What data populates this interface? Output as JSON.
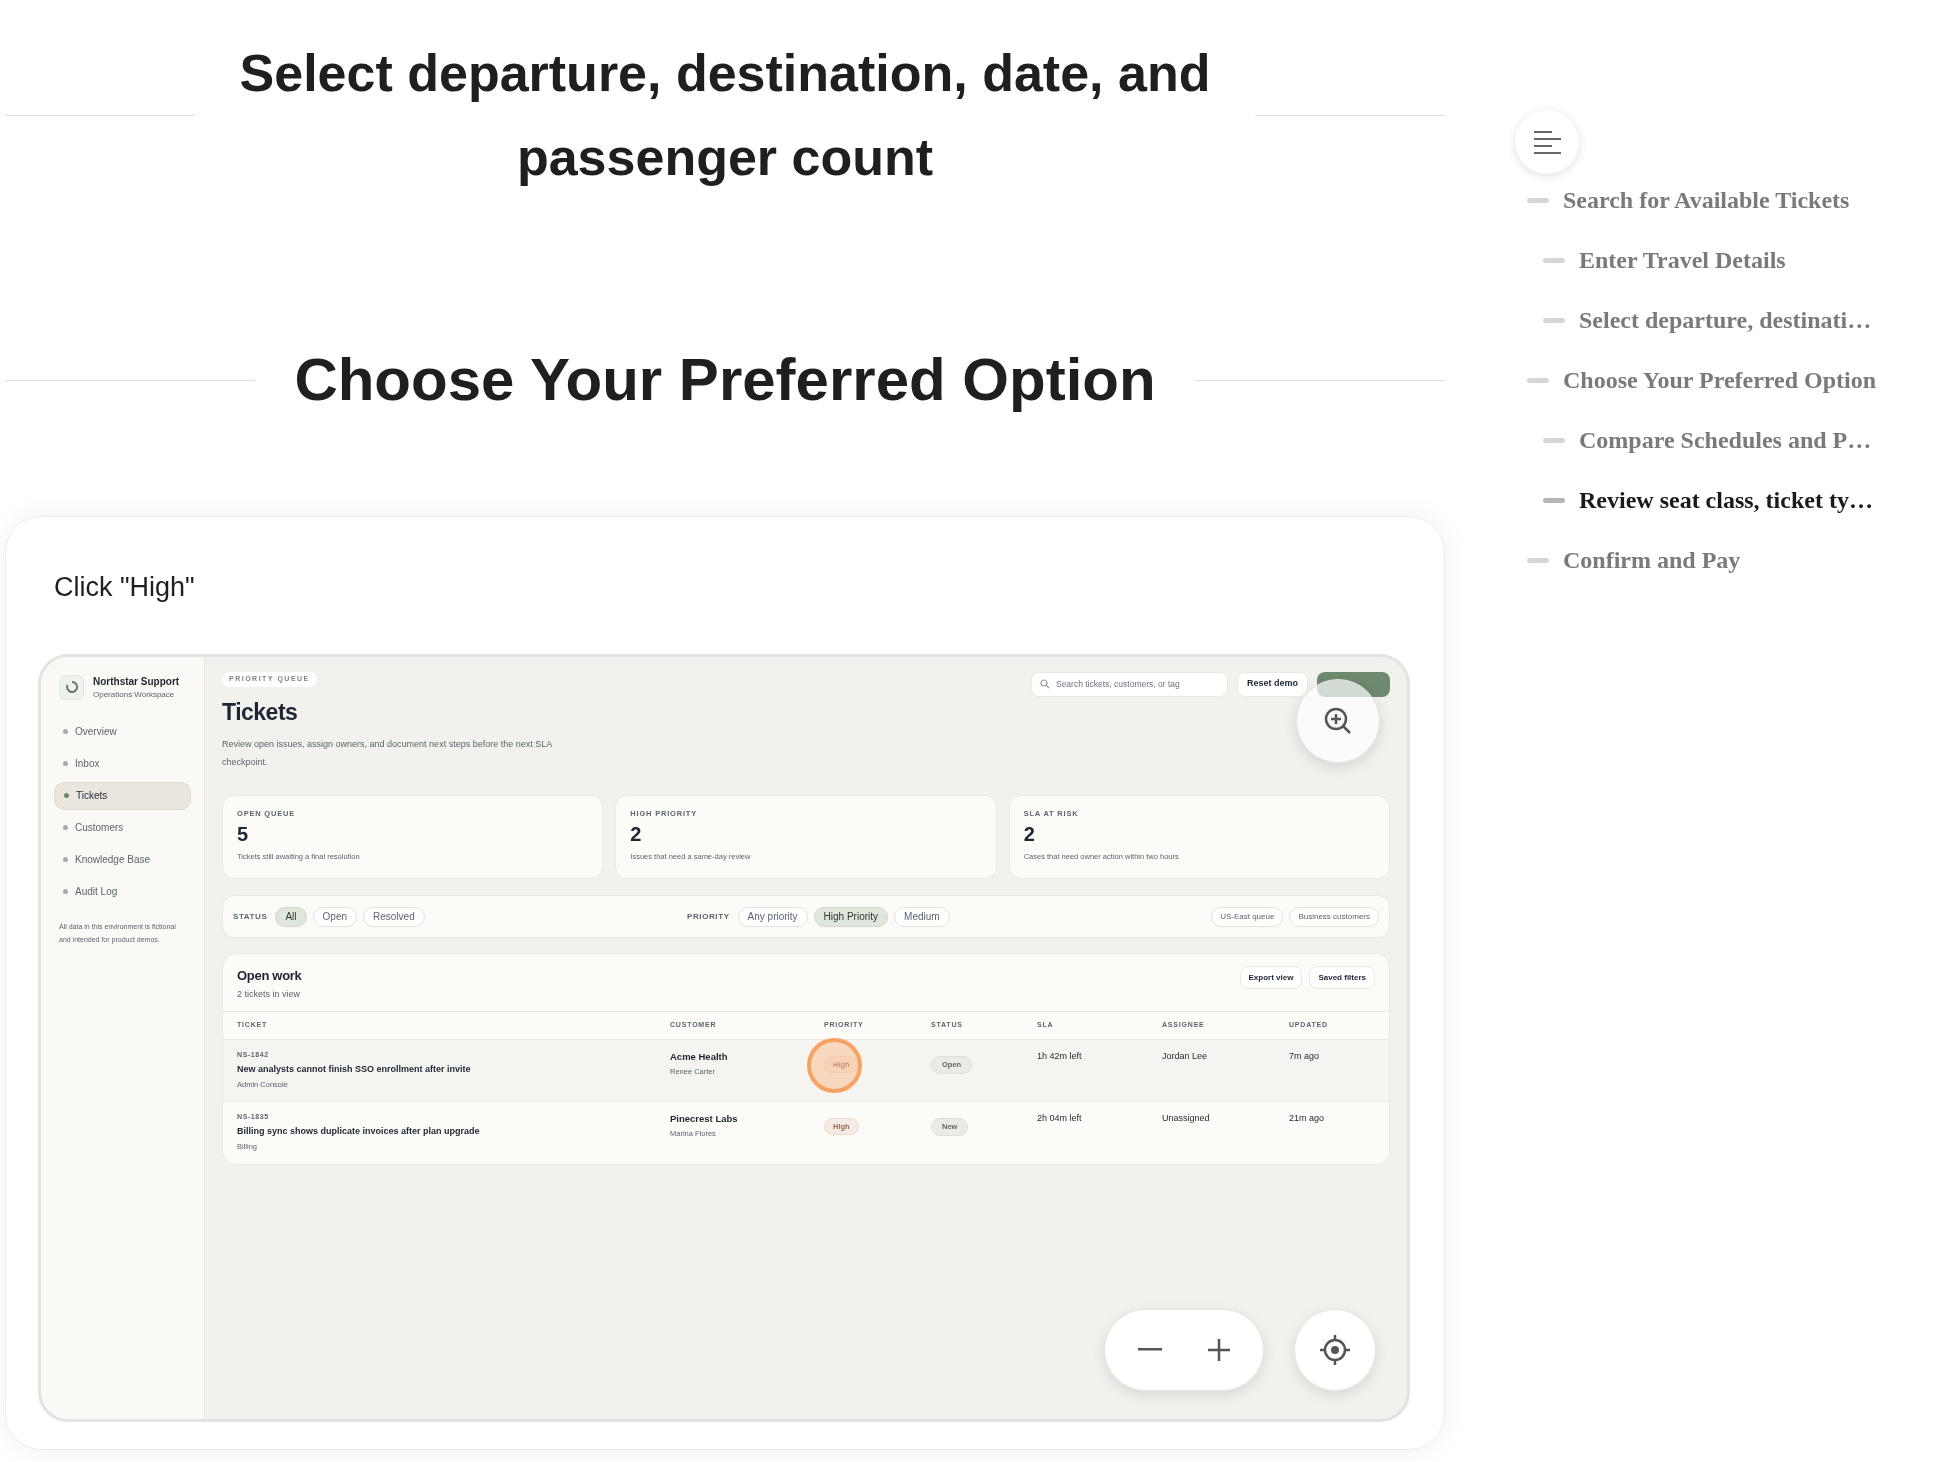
{
  "headings": [
    {
      "text": "Select departure, destination, date, and passenger count"
    },
    {
      "text": "Choose Your Preferred Option"
    }
  ],
  "step": {
    "instruction": "Click \"High\""
  },
  "app": {
    "brand": {
      "name": "Northstar Support",
      "subtitle": "Operations Workspace"
    },
    "nav": [
      {
        "label": "Overview",
        "selected": false
      },
      {
        "label": "Inbox",
        "selected": false
      },
      {
        "label": "Tickets",
        "selected": true
      },
      {
        "label": "Customers",
        "selected": false
      },
      {
        "label": "Knowledge Base",
        "selected": false
      },
      {
        "label": "Audit Log",
        "selected": false
      }
    ],
    "footnote": "All data in this environment is fictional and intended for product demos.",
    "eyebrow": "PRIORITY QUEUE",
    "title": "Tickets",
    "description": "Review open issues, assign owners, and document next steps before the next SLA checkpoint.",
    "search": {
      "placeholder": "Search tickets, customers, or tag"
    },
    "reset_button": "Reset demo",
    "stats": [
      {
        "label": "OPEN QUEUE",
        "value": "5",
        "note": "Tickets still awaiting a final resolution"
      },
      {
        "label": "HIGH PRIORITY",
        "value": "2",
        "note": "Issues that need a same-day review"
      },
      {
        "label": "SLA AT RISK",
        "value": "2",
        "note": "Cases that need owner action within two hours"
      }
    ],
    "filters": {
      "status": {
        "label": "STATUS",
        "chips": [
          {
            "label": "All",
            "selected": true
          },
          {
            "label": "Open",
            "selected": false
          },
          {
            "label": "Resolved",
            "selected": false
          }
        ]
      },
      "priority": {
        "label": "PRIORITY",
        "chips": [
          {
            "label": "Any priority",
            "selected": false
          },
          {
            "label": "High Priority",
            "selected": true
          },
          {
            "label": "Medium",
            "selected": false
          }
        ]
      },
      "tags": [
        "US-East queue",
        "Business customers"
      ]
    },
    "table": {
      "title": "Open work",
      "subtitle": "2 tickets in view",
      "actions": [
        "Export view",
        "Saved filters"
      ],
      "columns": [
        "TICKET",
        "CUSTOMER",
        "PRIORITY",
        "STATUS",
        "SLA",
        "ASSIGNEE",
        "UPDATED"
      ],
      "rows": [
        {
          "id": "NS-1842",
          "title": "New analysts cannot finish SSO enrollment after invite",
          "area": "Admin Console",
          "customer": "Acme Health",
          "contact": "Renee Carter",
          "priority": "High",
          "status": "Open",
          "sla": "1h 42m left",
          "assignee": "Jordan Lee",
          "updated": "7m ago",
          "selected": true,
          "highlighted": true
        },
        {
          "id": "NS-1835",
          "title": "Billing sync shows duplicate invoices after plan upgrade",
          "area": "Billing",
          "customer": "Pinecrest Labs",
          "contact": "Marina Flores",
          "priority": "High",
          "status": "New",
          "sla": "2h 04m left",
          "assignee": "Unassigned",
          "updated": "21m ago",
          "selected": false,
          "highlighted": false
        }
      ]
    }
  },
  "toc": [
    {
      "label": "Search for Available Tickets",
      "selected": false,
      "children": [
        {
          "label": "Enter Travel Details",
          "selected": false
        },
        {
          "label": "Select departure, destinati…",
          "selected": false
        }
      ]
    },
    {
      "label": "Choose Your Preferred Option",
      "selected": false,
      "children": [
        {
          "label": "Compare Schedules and P…",
          "selected": false
        },
        {
          "label": "Review seat class, ticket ty…",
          "selected": true
        }
      ]
    },
    {
      "label": "Confirm and Pay",
      "selected": false
    }
  ]
}
